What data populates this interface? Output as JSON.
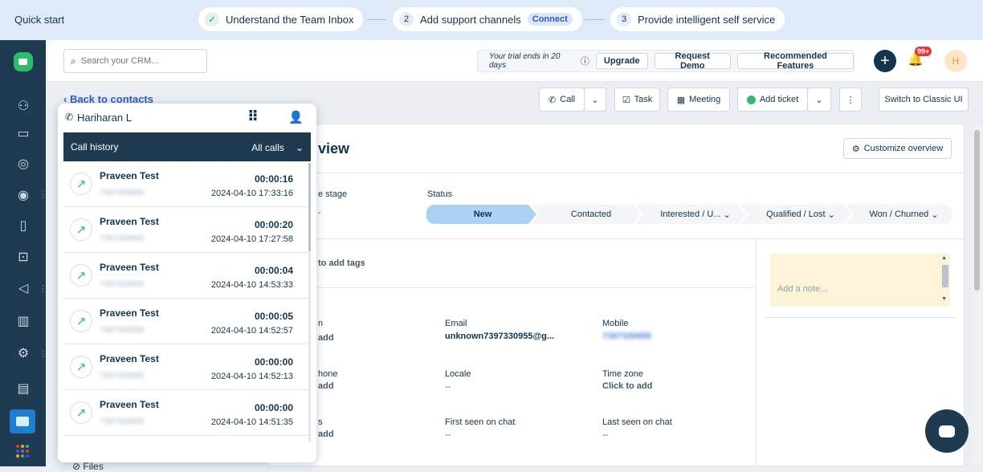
{
  "quickstart": {
    "title": "Quick start",
    "steps": [
      {
        "marker": "✓",
        "label": "Understand the Team Inbox"
      },
      {
        "marker": "2",
        "label": "Add support channels",
        "pill": "Connect"
      },
      {
        "marker": "3",
        "label": "Provide intelligent self service"
      }
    ]
  },
  "header": {
    "search_placeholder": "Search your CRM...",
    "trial_text": "Your trial ends in 20 days",
    "upgrade": "Upgrade",
    "request_demo": "Request Demo",
    "recommended": "Recommended Features",
    "notif_badge": "99+",
    "avatar_initial": "H"
  },
  "toolbar": {
    "back": "Back to contacts",
    "call": "Call",
    "task": "Task",
    "meeting": "Meeting",
    "add_ticket": "Add ticket",
    "switch_ui": "Switch to Classic UI"
  },
  "overview": {
    "title_fragment": "view",
    "customize": "Customize overview",
    "stage_label_fragment": "e stage",
    "stage_value_fragment": "-",
    "status_label": "Status",
    "pipeline": [
      "New",
      "Contacted",
      "Interested / U...",
      "Qualified / Lost",
      "Won / Churned"
    ],
    "tags_fragment": "to add tags",
    "note_placeholder": "Add a note...",
    "fields": [
      {
        "label": "n",
        "value": "add"
      },
      {
        "label": "Email",
        "value": "unknown7397330955@g..."
      },
      {
        "label": "Mobile",
        "value": "7397330955"
      },
      {
        "label": "hone",
        "value": "add"
      },
      {
        "label": "Locale",
        "value": "--"
      },
      {
        "label": "Time zone",
        "value": "Click to add"
      },
      {
        "label": "s",
        "value": "add"
      },
      {
        "label": "First seen on chat",
        "value": "--"
      },
      {
        "label": "Last seen on chat",
        "value": "--"
      }
    ],
    "files": "Files"
  },
  "phone": {
    "agent": "Hariharan L",
    "history_title": "Call history",
    "filter": "All calls",
    "calls": [
      {
        "name": "Praveen Test",
        "number": "7397330955",
        "duration": "00:00:16",
        "date": "2024-04-10 17:33:16"
      },
      {
        "name": "Praveen Test",
        "number": "7397330955",
        "duration": "00:00:20",
        "date": "2024-04-10 17:27:58"
      },
      {
        "name": "Praveen Test",
        "number": "7397330955",
        "duration": "00:00:04",
        "date": "2024-04-10 14:53:33"
      },
      {
        "name": "Praveen Test",
        "number": "7397330955",
        "duration": "00:00:05",
        "date": "2024-04-10 14:52:57"
      },
      {
        "name": "Praveen Test",
        "number": "7397330955",
        "duration": "00:00:00",
        "date": "2024-04-10 14:52:13"
      },
      {
        "name": "Praveen Test",
        "number": "7397330955",
        "duration": "00:00:00",
        "date": "2024-04-10 14:51:35"
      }
    ]
  },
  "colors": {
    "sidebar": "#1f3b52",
    "accent": "#2c5cc5",
    "green": "#2fbd6d",
    "pipeline_active": "#a9d2f5"
  }
}
